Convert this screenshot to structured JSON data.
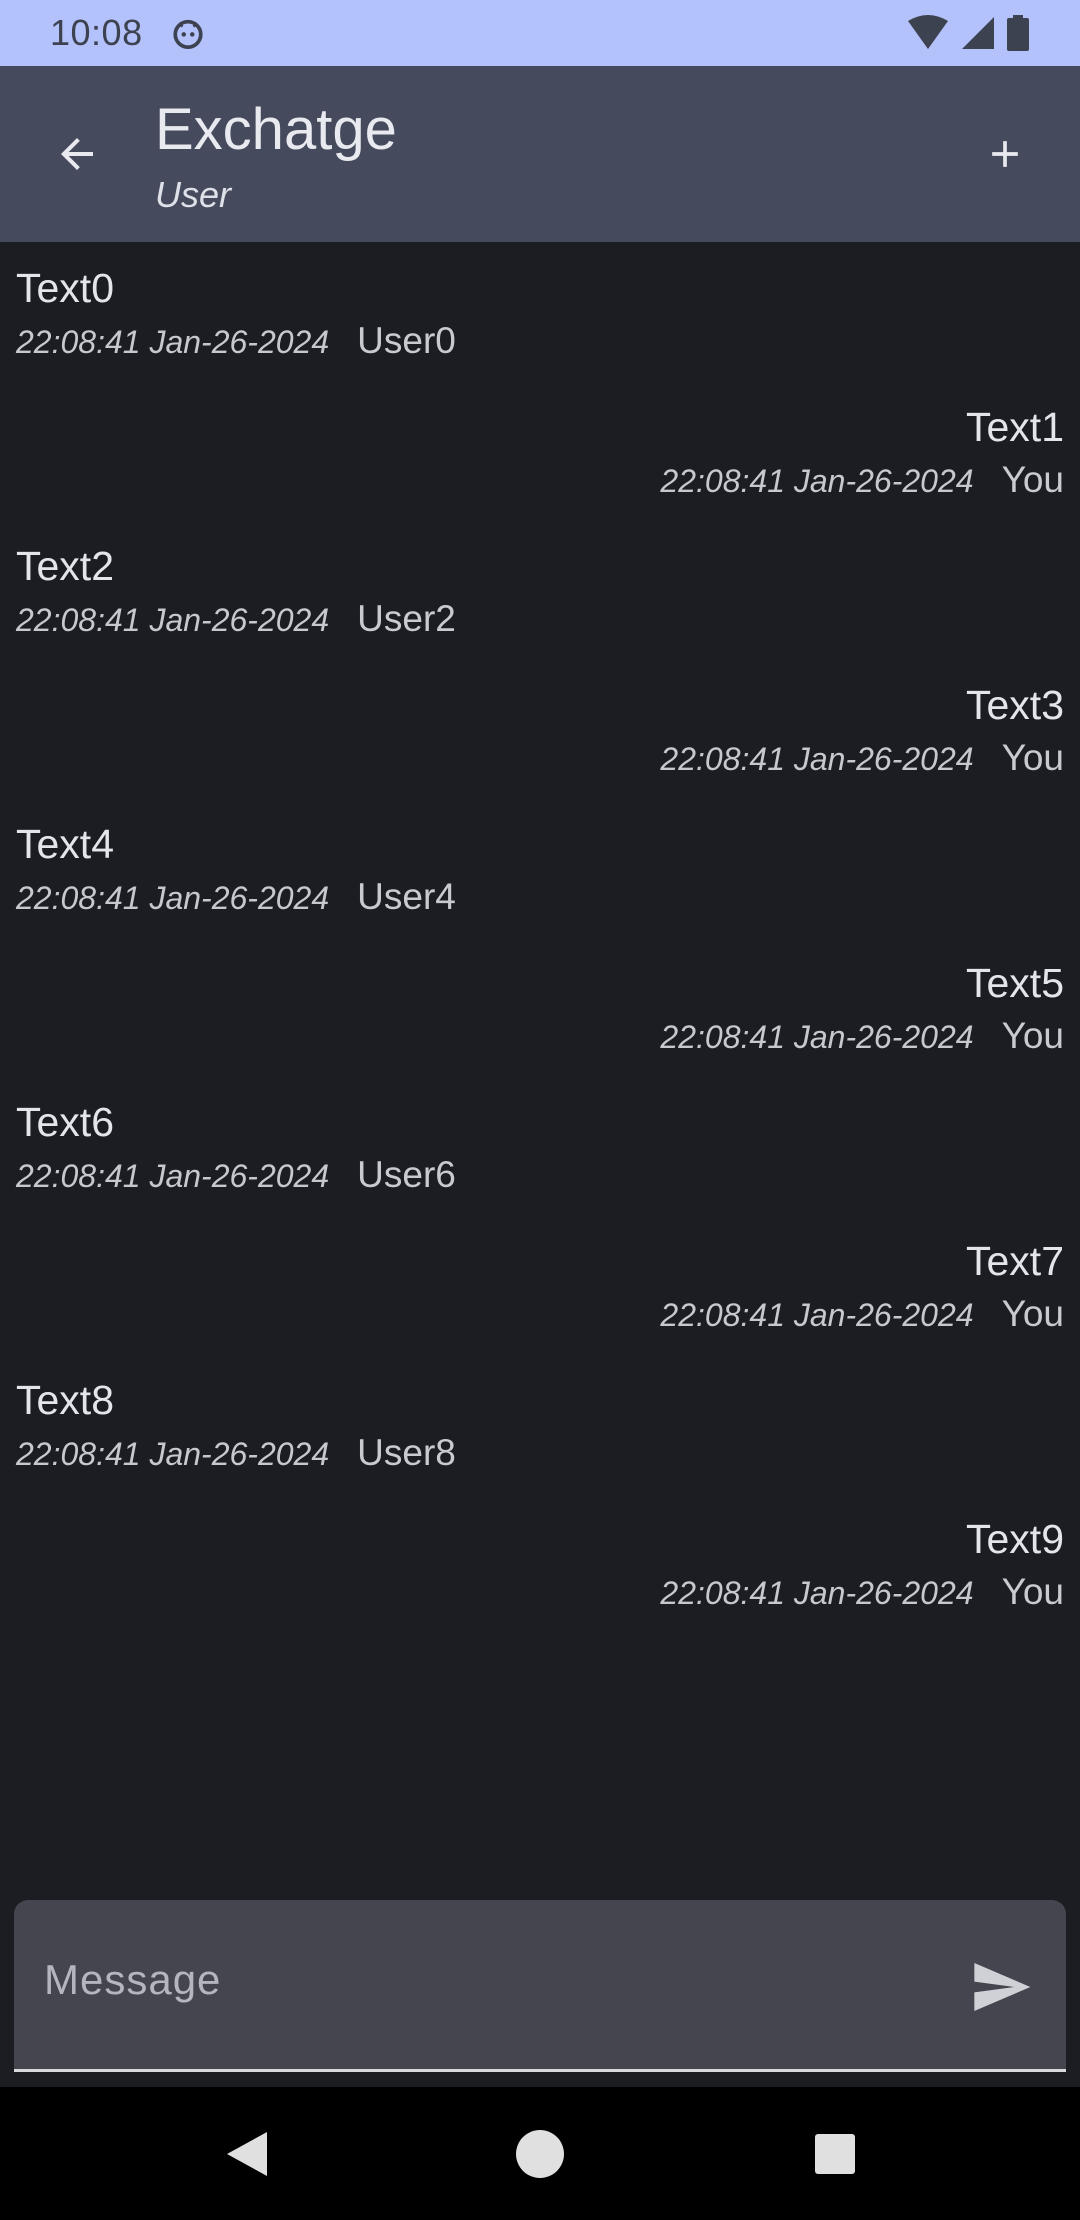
{
  "status_bar": {
    "time": "10:08",
    "app_icon": "android-face-icon",
    "wifi_icon": "wifi-icon",
    "signal_icon": "cell-signal-icon",
    "battery_icon": "battery-icon"
  },
  "toolbar": {
    "title": "Exchatge",
    "subtitle": "User",
    "back_icon": "arrow-back-icon",
    "add_icon": "plus-icon"
  },
  "messages": [
    {
      "text": "Text0",
      "time": "22:08:41 Jan-26-2024",
      "author": "User0",
      "mine": false
    },
    {
      "text": "Text1",
      "time": "22:08:41 Jan-26-2024",
      "author": "You",
      "mine": true
    },
    {
      "text": "Text2",
      "time": "22:08:41 Jan-26-2024",
      "author": "User2",
      "mine": false
    },
    {
      "text": "Text3",
      "time": "22:08:41 Jan-26-2024",
      "author": "You",
      "mine": true
    },
    {
      "text": "Text4",
      "time": "22:08:41 Jan-26-2024",
      "author": "User4",
      "mine": false
    },
    {
      "text": "Text5",
      "time": "22:08:41 Jan-26-2024",
      "author": "You",
      "mine": true
    },
    {
      "text": "Text6",
      "time": "22:08:41 Jan-26-2024",
      "author": "User6",
      "mine": false
    },
    {
      "text": "Text7",
      "time": "22:08:41 Jan-26-2024",
      "author": "You",
      "mine": true
    },
    {
      "text": "Text8",
      "time": "22:08:41 Jan-26-2024",
      "author": "User8",
      "mine": false
    },
    {
      "text": "Text9",
      "time": "22:08:41 Jan-26-2024",
      "author": "You",
      "mine": true
    }
  ],
  "composer": {
    "value": "",
    "placeholder": "Message",
    "send_icon": "send-icon"
  },
  "nav_bar": {
    "back_icon": "nav-back-icon",
    "home_icon": "nav-home-icon",
    "recents_icon": "nav-recents-icon"
  },
  "colors": {
    "status_bar_bg": "#b3c2fb",
    "toolbar_bg": "#454a5d",
    "background": "#1c1d22",
    "input_bg": "#45454f"
  }
}
